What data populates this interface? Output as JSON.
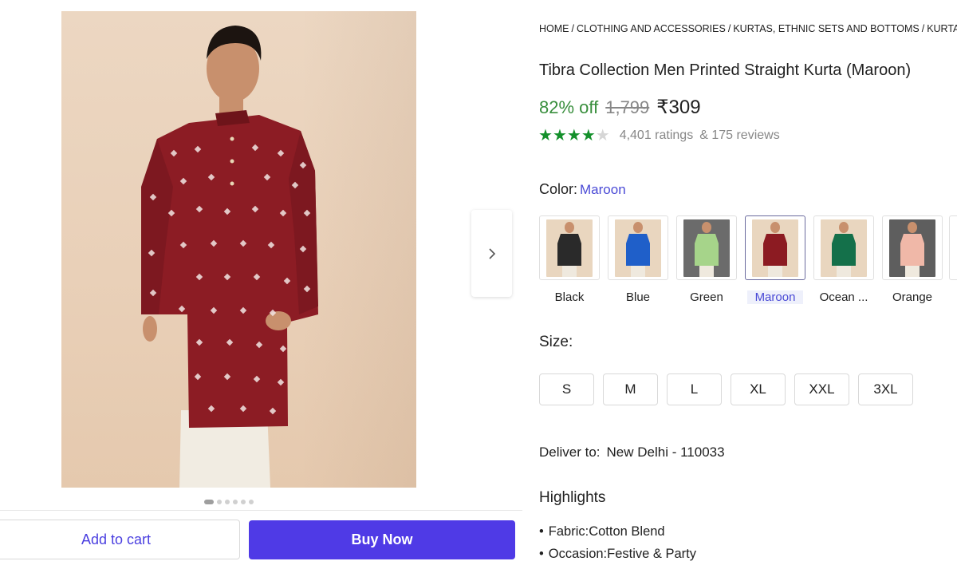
{
  "gallery": {
    "dots_count": 6,
    "active_dot": 0
  },
  "actions": {
    "add_to_cart_label": "Add to cart",
    "buy_now_label": "Buy Now"
  },
  "breadcrumb": [
    "HOME",
    "CLOTHING AND ACCESSORIES",
    "KURTAS, ETHNIC SETS AND BOTTOMS",
    "KURTAS"
  ],
  "product": {
    "title": "Tibra Collection Men Printed Straight Kurta (Maroon)",
    "discount": "82% off",
    "mrp": "1,799",
    "price": "₹309",
    "rating_stars": 4,
    "ratings_text": "4,401 ratings",
    "reviews_text": "& 175 reviews"
  },
  "color": {
    "label": "Color:",
    "selected": "Maroon",
    "options": [
      {
        "name": "Black",
        "kurta": "#2a2a2a",
        "bg": "#e9d6bf"
      },
      {
        "name": "Blue",
        "kurta": "#1f5fc9",
        "bg": "#e9d6bf"
      },
      {
        "name": "Green",
        "kurta": "#a6d48a",
        "bg": "#6b6b6b"
      },
      {
        "name": "Maroon",
        "kurta": "#8c1b22",
        "bg": "#e9d6bf"
      },
      {
        "name": "Ocean ...",
        "kurta": "#14704a",
        "bg": "#e9d6bf"
      },
      {
        "name": "Orange",
        "kurta": "#f0b8a8",
        "bg": "#5e5e5e"
      }
    ]
  },
  "size": {
    "label": "Size:",
    "options": [
      "S",
      "M",
      "L",
      "XL",
      "XXL",
      "3XL"
    ]
  },
  "delivery": {
    "label": "Deliver to:",
    "location": "New Delhi - 110033"
  },
  "highlights": {
    "title": "Highlights",
    "items": [
      "Fabric:Cotton Blend",
      "Occasion:Festive & Party"
    ]
  },
  "colors": {
    "primary": "#4f3ae6",
    "discount_green": "#388e3c",
    "star_green": "#14902b",
    "link_blue": "#4a4ad6"
  }
}
